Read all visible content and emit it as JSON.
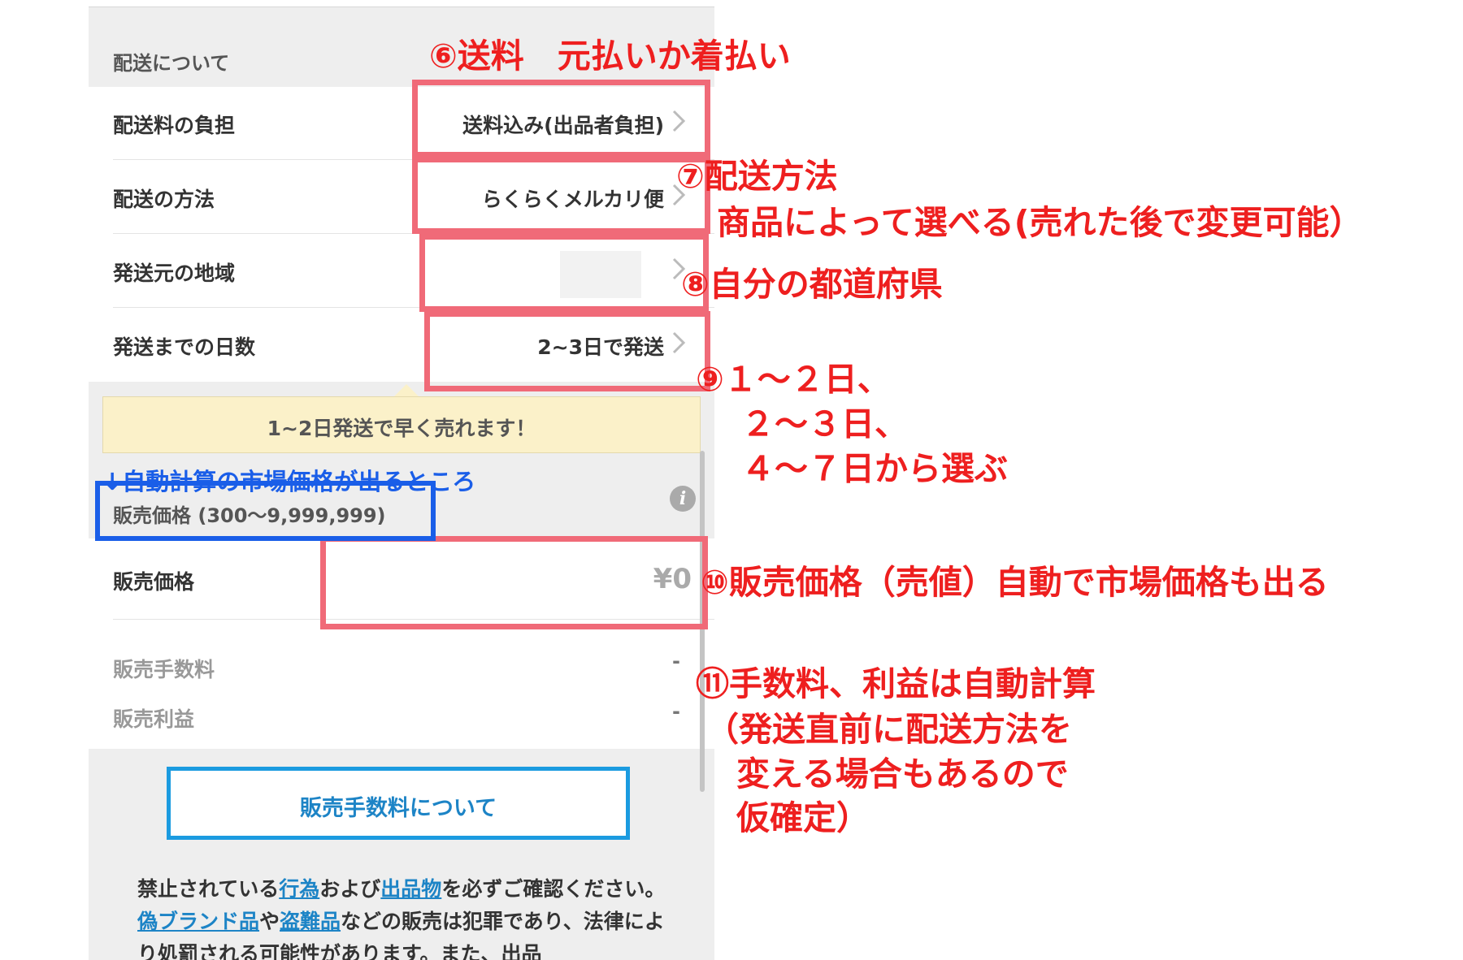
{
  "shipping": {
    "section_title": "配送について",
    "rows": [
      {
        "label": "配送料の負担",
        "value": "送料込み(出品者負担)"
      },
      {
        "label": "配送の方法",
        "value": "らくらくメルカリ便"
      },
      {
        "label": "発送元の地域",
        "value": ""
      },
      {
        "label": "発送までの日数",
        "value": "2~3日で発送"
      }
    ],
    "tip": "1~2日発送で早く売れます！"
  },
  "price": {
    "section_title": "販売価格 (300〜9,999,999)",
    "label": "販売価格",
    "value": "¥0",
    "fee_label": "販売手数料",
    "fee_value": "-",
    "profit_label": "販売利益",
    "profit_value": "-",
    "fee_button": "販売手数料について"
  },
  "disclaimer": {
    "t1": "禁止されている",
    "link1": "行為",
    "t2": "および",
    "link2": "出品物",
    "t3": "を必ずご確認ください。",
    "link3": "偽ブランド品",
    "t4": "や",
    "link4": "盗難品",
    "t5": "などの販売は犯罪であり、法律により処罰される可能性があります。また、出品"
  },
  "annotations": {
    "a6": "⑥送料　元払いか着払い",
    "a7_line1": "⑦配送方法",
    "a7_line2": "商品によって選べる(売れた後で変更可能）",
    "a8": "⑧自分の都道府県",
    "a9_line1": "⑨１～２日、",
    "a9_line2": "２～３日、",
    "a9_line3": "４～７日から選ぶ",
    "market_note": "↓自動計算の市場価格が出るところ",
    "a10": "⑩販売価格（売値）自動で市場価格も出る",
    "a11_line1": "⑪手数料、利益は自動計算",
    "a11_line2": "（発送直前に配送方法を",
    "a11_line3": "変える場合もあるので",
    "a11_line4": "仮確定）"
  },
  "colors": {
    "annotation_red": "#ee1f1f",
    "highlight_box": "#f06a78",
    "annotation_blue": "#1a5ee8",
    "button_border": "#1b9be0",
    "link": "#1d84c6",
    "tip_background": "#fbf1c9"
  }
}
